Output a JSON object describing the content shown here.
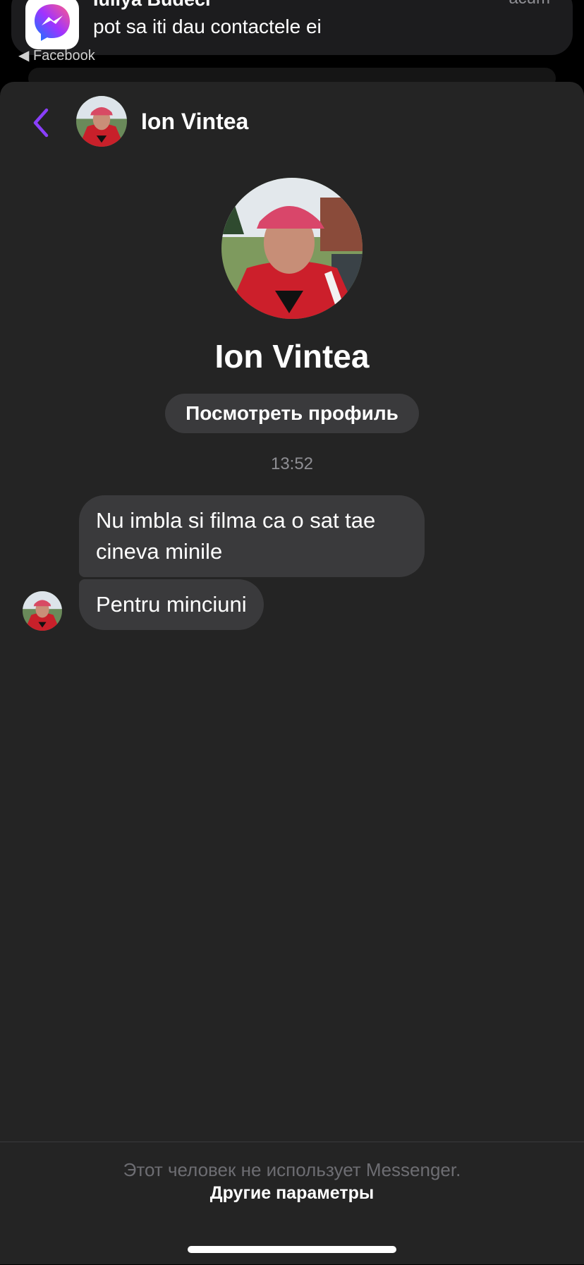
{
  "notification": {
    "app_icon": "messenger-icon",
    "title": "Iuliya Budeci",
    "message": "pot sa iti dau contactele ei",
    "time": "acum",
    "source": "◀ Facebook"
  },
  "header": {
    "back_icon": "chevron-left-icon",
    "contact_name": "Ion Vintea",
    "accent_color": "#8a3ffc"
  },
  "profile": {
    "name": "Ion Vintea",
    "view_profile_label": "Посмотреть профиль"
  },
  "conversation": {
    "timestamp": "13:52",
    "messages": [
      {
        "text": "Nu imbla si filma ca o sat tae cineva minile"
      },
      {
        "text": "Pentru minciuni"
      }
    ]
  },
  "footer": {
    "note": "Этот человек не использует Messenger.",
    "other_options_label": "Другие параметры"
  }
}
